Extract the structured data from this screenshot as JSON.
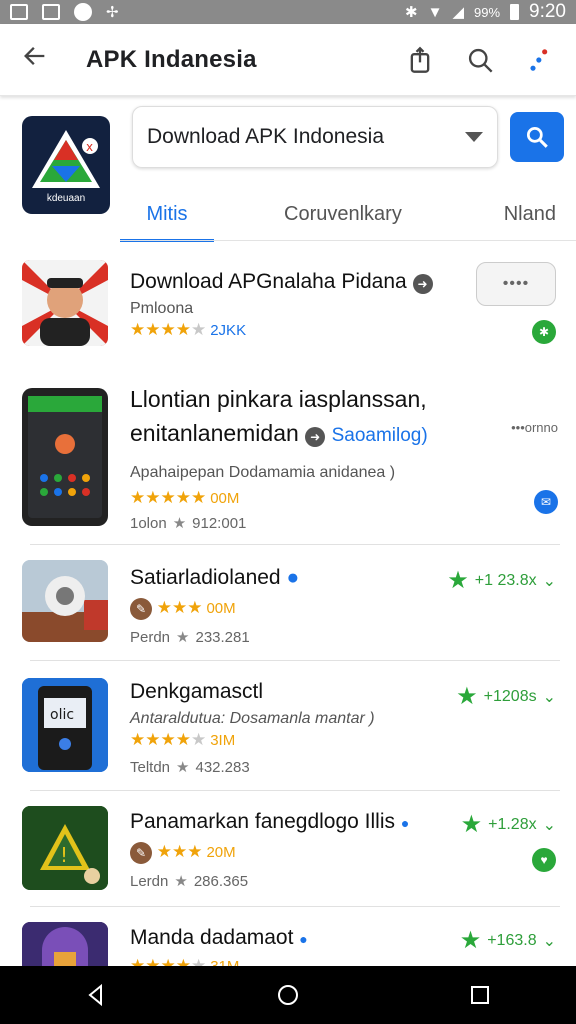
{
  "status": {
    "battery": "99%",
    "time": "9:20"
  },
  "appbar": {
    "title": "APK Indanesia"
  },
  "hero": {
    "icon_label": "kdeuaan"
  },
  "search": {
    "value": "Download APK Indonesia"
  },
  "tabs": [
    "Mitis",
    "Coruvenlkary",
    "Nland"
  ],
  "items": [
    {
      "name": "Download APGnalaha Pidana",
      "sub": "Pmloona",
      "rating_count": "2JKK",
      "menu_label": "••••"
    },
    {
      "name_line1": "Llontian pinkara iasplanssan,",
      "name_line2": "enitanlanemidan",
      "tag": "Saoamilog)",
      "menu_label": "•••ornno",
      "desc": "Apahaipepan Dodamamia anidanea )",
      "rating_count": "00M",
      "meta_label": "1olon",
      "meta_value": "912:001"
    },
    {
      "name": "Satiarladiolaned",
      "rating_count": "00M",
      "meta_label": "Perdn",
      "meta_value": "233.281",
      "grade": "+1 23.8x"
    },
    {
      "name": "Denkgamasctl",
      "desc": "Antaraldutua: Dosamanla mantar )",
      "rating_count": "3IM",
      "meta_label": "Teltdn",
      "meta_value": "432.283",
      "grade": "+1208s"
    },
    {
      "name": "Panamarkan fanegdlogo Illis",
      "rating_count": "20M",
      "meta_label": "Lerdn",
      "meta_value": "286.365",
      "grade": "+1.28x"
    },
    {
      "name": "Manda dadamaot",
      "rating_count": "31M",
      "grade": "+163.8"
    }
  ],
  "colors": {
    "accent": "#1a73e8",
    "star": "#f0a30a",
    "green": "#2aa83a"
  }
}
